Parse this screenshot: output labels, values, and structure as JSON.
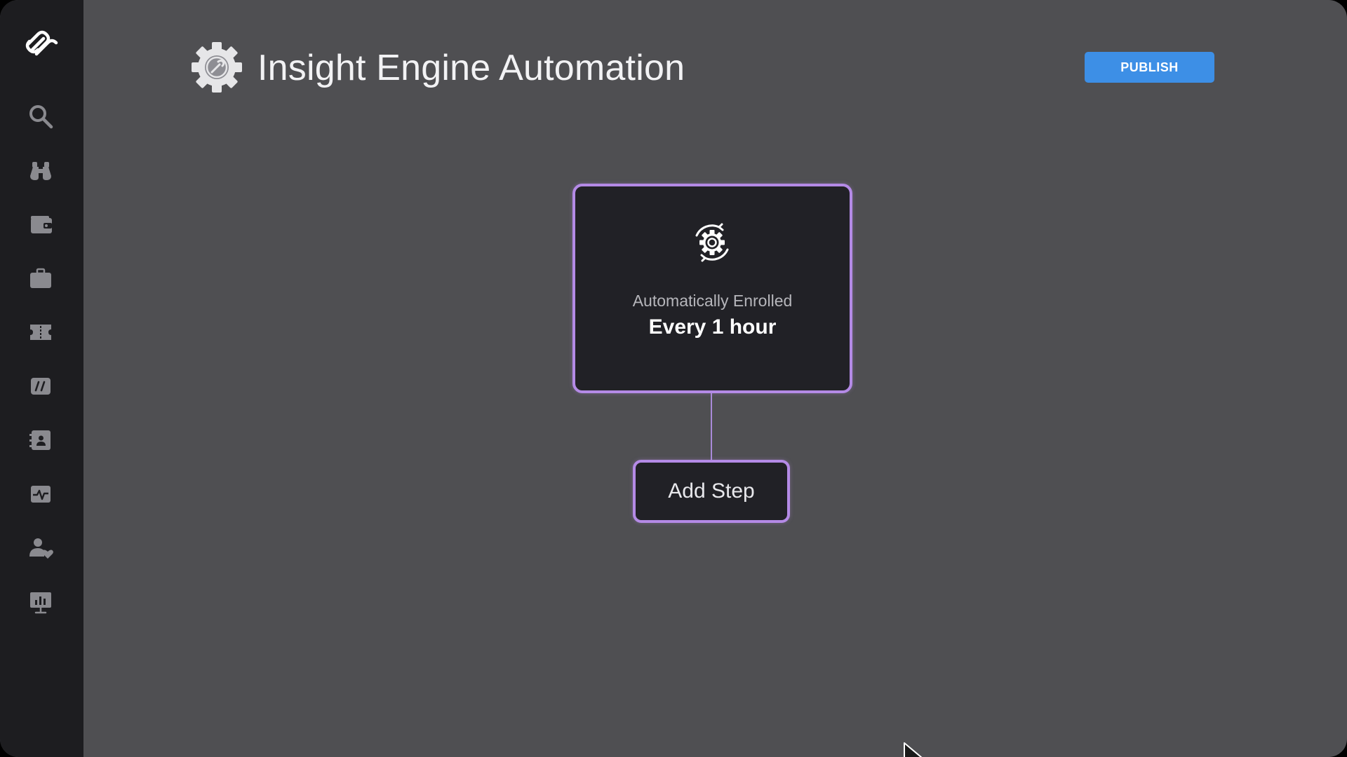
{
  "app": {
    "title": "Insight Engine Automation",
    "publish_label": "PUBLISH"
  },
  "sidebar": {
    "items": [
      {
        "icon": "search-icon"
      },
      {
        "icon": "binoculars-icon"
      },
      {
        "icon": "wallet-icon"
      },
      {
        "icon": "briefcase-icon"
      },
      {
        "icon": "ticket-icon"
      },
      {
        "icon": "hashtag-icon"
      },
      {
        "icon": "contact-card-icon"
      },
      {
        "icon": "activity-icon"
      },
      {
        "icon": "user-heart-icon"
      },
      {
        "icon": "presentation-chart-icon"
      }
    ]
  },
  "workflow": {
    "trigger": {
      "label": "Automatically Enrolled",
      "value": "Every 1 hour"
    },
    "add_step_label": "Add Step"
  },
  "colors": {
    "background": "#4f4f52",
    "sidebar": "#1d1d20",
    "card": "#212126",
    "accent_purple": "#b48ae6",
    "publish_blue": "#3d8fe6",
    "icon_gray": "#8a8a8f"
  }
}
